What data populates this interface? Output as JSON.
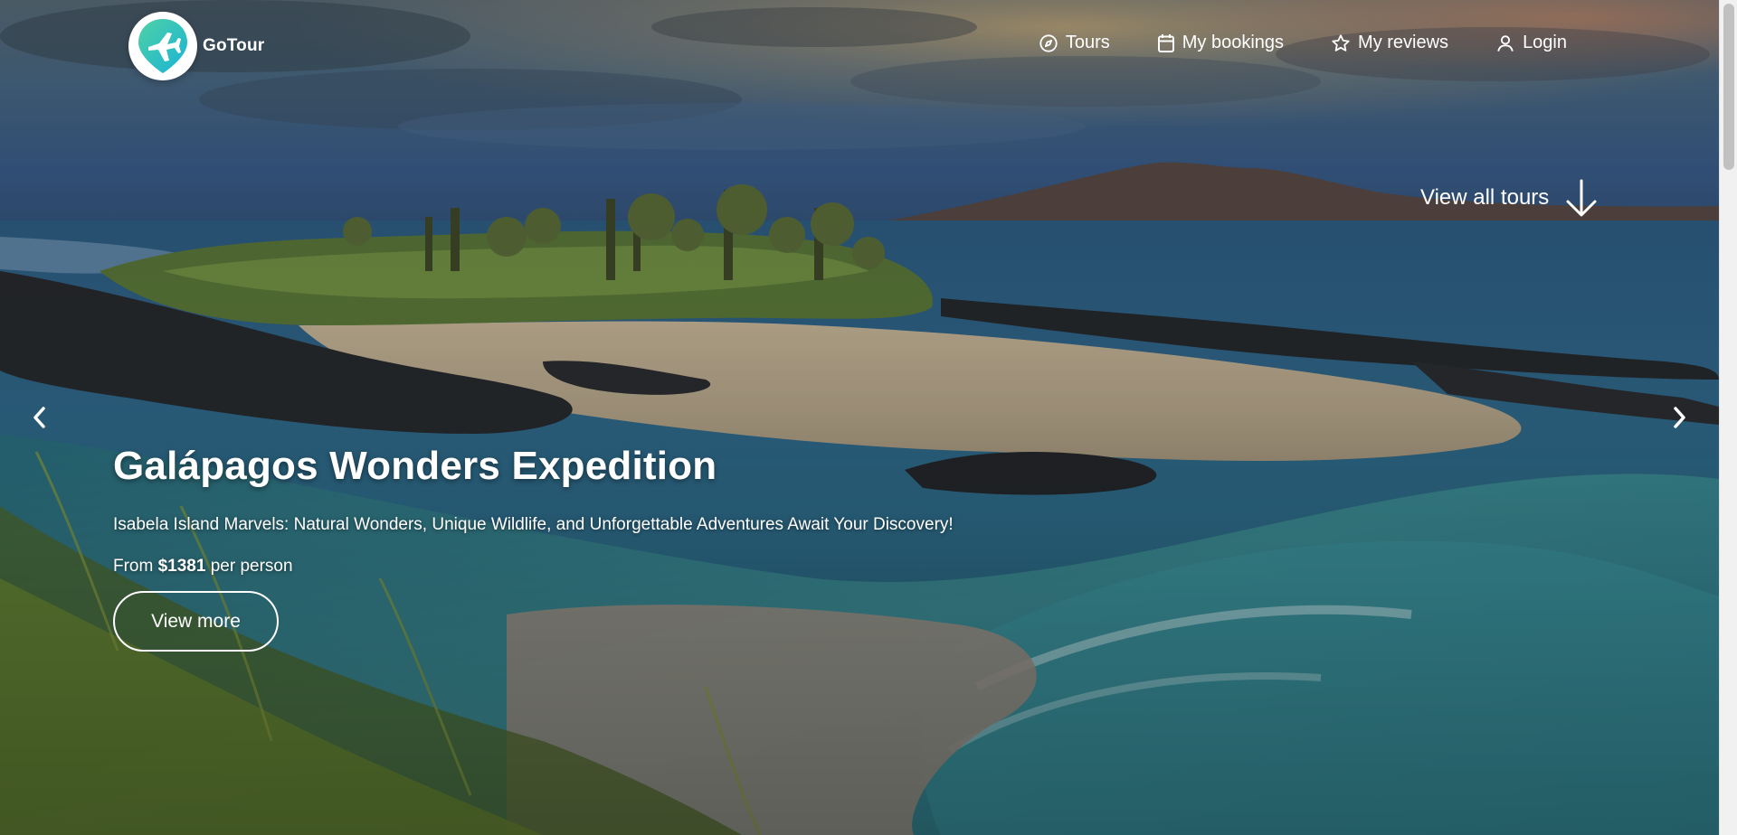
{
  "brand": {
    "name": "GoTour",
    "logo_icon": "airplane-icon",
    "logo_gradient": [
      "#4fd1a5",
      "#19b3d6"
    ]
  },
  "nav": {
    "items": [
      {
        "label": "Tours",
        "icon": "compass-icon"
      },
      {
        "label": "My bookings",
        "icon": "calendar-icon"
      },
      {
        "label": "My reviews",
        "icon": "star-icon"
      },
      {
        "label": "Login",
        "icon": "user-icon"
      }
    ]
  },
  "view_all": {
    "label": "View all tours",
    "icon": "arrow-down-icon"
  },
  "hero": {
    "title": "Galápagos Wonders Expedition",
    "subtitle": "Isabela Island Marvels: Natural Wonders, Unique Wildlife, and Unforgettable Adventures Await Your Discovery!",
    "price_prefix": "From",
    "price": "$1381",
    "price_suffix": "per person",
    "button_label": "View more"
  },
  "carousel": {
    "prev_icon": "chevron-left-icon",
    "next_icon": "chevron-right-icon"
  }
}
